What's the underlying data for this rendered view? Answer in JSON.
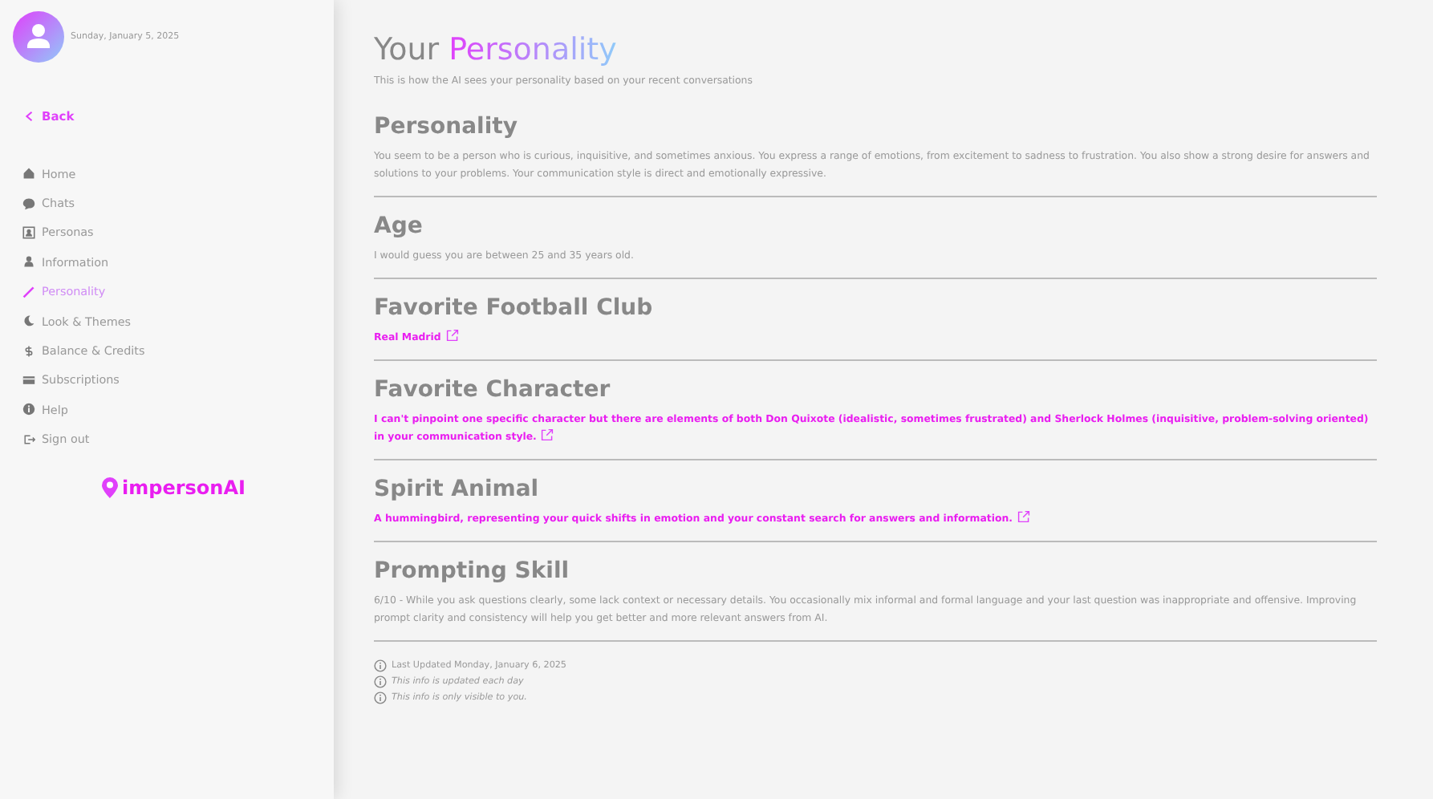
{
  "sidebar": {
    "date": "Sunday, January 5, 2025",
    "back": "Back",
    "items": [
      {
        "label": "Home",
        "selected": false
      },
      {
        "label": "Chats",
        "selected": false
      },
      {
        "label": "Personas",
        "selected": false
      },
      {
        "label": "Information",
        "selected": false
      },
      {
        "label": "Personality",
        "selected": true
      },
      {
        "label": "Look & Themes",
        "selected": false
      },
      {
        "label": "Balance & Credits",
        "selected": false
      },
      {
        "label": "Subscriptions",
        "selected": false
      },
      {
        "label": "Help",
        "selected": false
      },
      {
        "label": "Sign out",
        "selected": false
      }
    ],
    "brand": "impersonAI"
  },
  "header": {
    "title_lead": "Your",
    "title_highlight": "Personality",
    "subtitle": "This is how the AI sees your personality based on your recent conversations"
  },
  "sections": [
    {
      "heading": "Personality",
      "kind": "text",
      "text": "You seem to be a person who is curious, inquisitive, and sometimes anxious. You express a range of emotions, from excitement to sadness to frustration. You also show a strong desire for answers and solutions to your problems. Your communication style is direct and emotionally expressive."
    },
    {
      "heading": "Age",
      "kind": "text",
      "text": "I would guess you are between 25 and 35 years old."
    },
    {
      "heading": "Favorite Football Club",
      "kind": "link",
      "text": "Real Madrid"
    },
    {
      "heading": "Favorite Character",
      "kind": "link",
      "text": "I can't pinpoint one specific character but there are elements of both Don Quixote (idealistic, sometimes frustrated) and Sherlock Holmes (inquisitive, problem-solving oriented) in your communication style."
    },
    {
      "heading": "Spirit Animal",
      "kind": "link",
      "text": "A hummingbird, representing your quick shifts in emotion and your constant search for answers and information."
    },
    {
      "heading": "Prompting Skill",
      "kind": "text",
      "text": "6/10 - While you ask questions clearly, some lack context or necessary details. You occasionally mix informal and formal language and your last question was inappropriate and offensive. Improving prompt clarity and consistency will help you get better and more relevant answers from AI."
    }
  ],
  "notes": [
    {
      "text": "Last Updated Monday, January 6, 2025",
      "italic": false
    },
    {
      "text": "This info is updated each day",
      "italic": true
    },
    {
      "text": "This info is only visible to you.",
      "italic": true
    }
  ]
}
